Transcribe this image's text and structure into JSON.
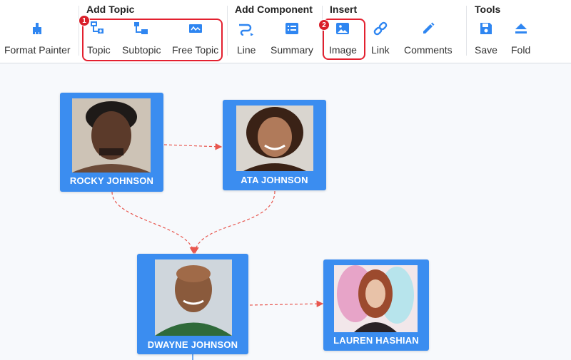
{
  "toolbar": {
    "format_painter": {
      "label": "Format Painter",
      "icon": "brush-icon"
    },
    "groups": {
      "add_topic": "Add Topic",
      "add_component": "Add Component",
      "insert": "Insert",
      "tools": "Tools"
    },
    "items": {
      "topic": "Topic",
      "subtopic": "Subtopic",
      "free_topic": "Free Topic",
      "line": "Line",
      "summary": "Summary",
      "image": "Image",
      "link": "Link",
      "comments": "Comments",
      "save": "Save",
      "fold": "Fold"
    },
    "badges": {
      "first": "1",
      "second": "2"
    },
    "icon_color": "#2f86f1",
    "highlight_color": "#e3202f"
  },
  "mindmap": {
    "node_color": "#3b8df0",
    "connector_color": "#e8574f",
    "nodes": {
      "rocky": "ROCKY JOHNSON",
      "ata": "ATA JOHNSON",
      "dwayne": "DWAYNE JOHNSON",
      "lauren": "LAUREN HASHIAN"
    }
  }
}
